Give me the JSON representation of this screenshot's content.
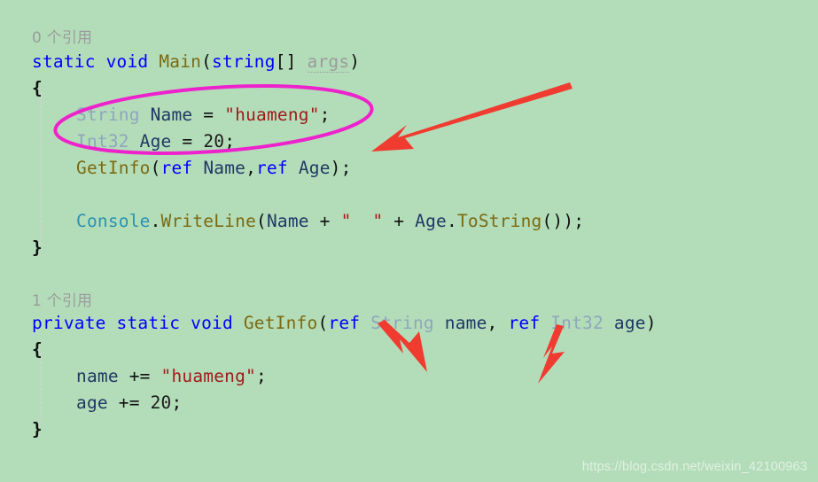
{
  "editor": {
    "background_color": "#b3ddb9",
    "language": "C#",
    "code_lines": [
      {
        "indent": 0,
        "kind": "codelens",
        "text": "0 个引用"
      },
      {
        "indent": 0,
        "kind": "code",
        "text": "static void Main(string[] args)"
      },
      {
        "indent": 0,
        "kind": "code",
        "text": "{"
      },
      {
        "indent": 1,
        "kind": "code",
        "text": "String Name = \"huameng\";"
      },
      {
        "indent": 1,
        "kind": "code",
        "text": "Int32 Age = 20;"
      },
      {
        "indent": 1,
        "kind": "code",
        "text": "GetInfo(ref Name,ref Age);"
      },
      {
        "indent": 1,
        "kind": "blank",
        "text": ""
      },
      {
        "indent": 1,
        "kind": "code",
        "text": "Console.WriteLine(Name + \"  \" + Age.ToString());"
      },
      {
        "indent": 0,
        "kind": "code",
        "text": "}"
      },
      {
        "indent": 0,
        "kind": "blank",
        "text": ""
      },
      {
        "indent": 0,
        "kind": "codelens",
        "text": "1 个引用"
      },
      {
        "indent": 0,
        "kind": "code",
        "text": "private static void GetInfo(ref String name, ref Int32 age)"
      },
      {
        "indent": 0,
        "kind": "code",
        "text": "{"
      },
      {
        "indent": 1,
        "kind": "code",
        "text": "name += \"huameng\";"
      },
      {
        "indent": 1,
        "kind": "code",
        "text": "age += 20;"
      },
      {
        "indent": 0,
        "kind": "code",
        "text": "}"
      }
    ],
    "tokens": {
      "kw_static": "static",
      "kw_void": "void",
      "kw_private": "private",
      "kw_string": "string",
      "kw_ref": "ref",
      "method_main": "Main",
      "method_getinfo": "GetInfo",
      "method_writeline": "WriteLine",
      "method_tostring": "ToString",
      "class_console": "Console",
      "type_String": "String",
      "type_Int32": "Int32",
      "var_Name": "Name",
      "var_Age": "Age",
      "var_name": "name",
      "var_age": "age",
      "param_args": "args",
      "literal_huameng": "\"huameng\"",
      "literal_20": "20",
      "literal_spaces": "\"  \""
    },
    "codelens": {
      "main_refs": "0 个引用",
      "getinfo_refs": "1 个引用"
    },
    "colors": {
      "keyword": "#0000ff",
      "type_alias": "#8fa6bc",
      "class_name": "#2b91af",
      "method_name": "#7b6a12",
      "string_literal": "#a01b1b",
      "identifier": "#1f3864",
      "codelens": "#9b9b9b",
      "punctuation": "#101010"
    }
  },
  "annotations": {
    "ellipse": {
      "name": "magenta-highlight-ellipse",
      "color": "#ee22cc",
      "target": "String Name / Int32 Age declarations"
    },
    "arrows": [
      {
        "name": "arrow-to-declarations",
        "color": "#f03b30",
        "points_to": "String Name = \"huameng\"; / Int32 Age = 20;"
      },
      {
        "name": "arrow-to-ref-name",
        "color": "#f03b30",
        "points_to": "ref String name"
      },
      {
        "name": "arrow-to-ref-age",
        "color": "#f03b30",
        "points_to": "ref Int32 age"
      }
    ]
  },
  "watermark": {
    "text": "https://blog.csdn.net/weixin_42100963"
  }
}
